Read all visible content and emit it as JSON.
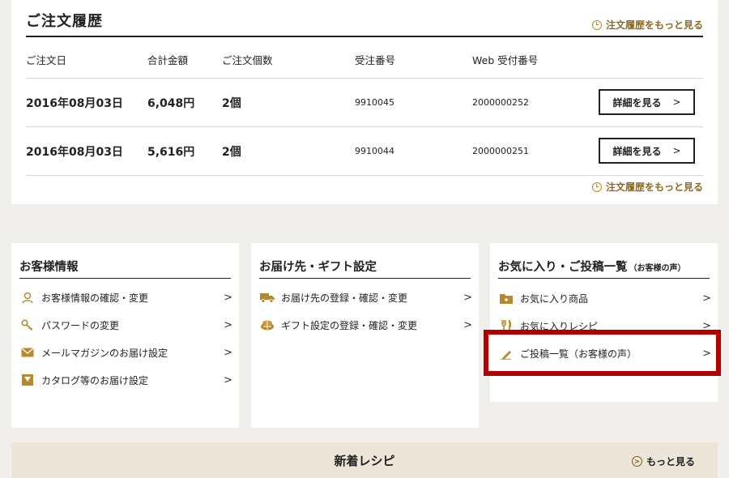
{
  "orders": {
    "title": "ご注文履歴",
    "more_label": "注文履歴をもっと見る",
    "columns": [
      "ご注文日",
      "合計金額",
      "ご注文個数",
      "受注番号",
      "Web 受付番号"
    ],
    "rows": [
      {
        "date": "2016年08月03日",
        "total": "6,048円",
        "count": "2個",
        "order_no": "9910045",
        "web_no": "2000000252",
        "button": "詳細を見る"
      },
      {
        "date": "2016年08月03日",
        "total": "5,616円",
        "count": "2個",
        "order_no": "9910044",
        "web_no": "2000000251",
        "button": "詳細を見る"
      }
    ]
  },
  "customer": {
    "title": "お客様情報",
    "items": [
      {
        "label": "お客様情報の確認・変更",
        "icon": "person-icon"
      },
      {
        "label": "パスワードの変更",
        "icon": "key-icon"
      },
      {
        "label": "メールマガジンのお届け設定",
        "icon": "envelope-icon"
      },
      {
        "label": "カタログ等のお届け設定",
        "icon": "catalog-icon"
      }
    ]
  },
  "delivery": {
    "title": "お届け先・ギフト設定",
    "items": [
      {
        "label": "お届け先の登録・確認・変更",
        "icon": "truck-icon"
      },
      {
        "label": "ギフト設定の登録・確認・変更",
        "icon": "gift-icon"
      }
    ]
  },
  "favorites": {
    "title": "お気に入り・ご投稿一覧",
    "title_sub": "（お客様の声）",
    "items": [
      {
        "label": "お気に入り商品",
        "icon": "folder-icon"
      },
      {
        "label": "お気に入りレシピ",
        "icon": "fork-knife-icon"
      },
      {
        "label": "ご投稿一覧（お客様の声）",
        "icon": "pencil-icon"
      }
    ]
  },
  "recipes": {
    "title": "新着レシピ",
    "more_label": "もっと見る"
  },
  "colors": {
    "accent": "#b8892c",
    "highlight": "#b00000",
    "recipes_bg": "#ebe6d8"
  }
}
